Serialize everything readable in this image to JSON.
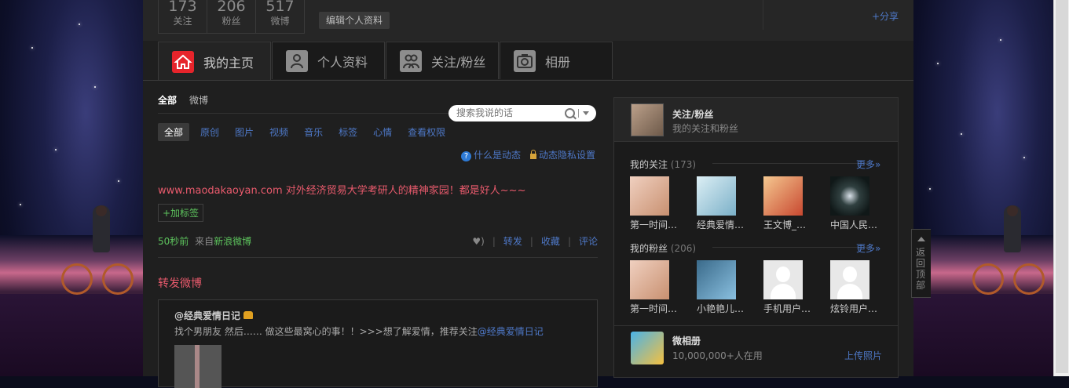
{
  "profile_stats": [
    {
      "value": "173",
      "label": "关注"
    },
    {
      "value": "206",
      "label": "粉丝"
    },
    {
      "value": "517",
      "label": "微博"
    }
  ],
  "edit_profile_label": "编辑个人资料",
  "share_label": "+分享",
  "tabs": [
    {
      "label": "我的主页",
      "icon": "home-icon",
      "active": true
    },
    {
      "label": "个人资料",
      "icon": "person-icon",
      "active": false
    },
    {
      "label": "关注/粉丝",
      "icon": "people-icon",
      "active": false
    },
    {
      "label": "相册",
      "icon": "camera-icon",
      "active": false
    }
  ],
  "feed_tabs": [
    "全部",
    "微博"
  ],
  "search": {
    "placeholder": "搜索我说的话"
  },
  "filters": [
    "全部",
    "原创",
    "图片",
    "视频",
    "音乐",
    "标签",
    "心情",
    "查看权限"
  ],
  "dynamic": {
    "what_is": "什么是动态",
    "privacy": "动态隐私设置"
  },
  "post": {
    "text": "www.maodakaoyan.com 对外经济贸易大学考研人的精神家园！都是好人~~~",
    "add_tag": "+加标签",
    "time": "50秒前",
    "source_prefix": "来自",
    "source": "新浪微博",
    "actions": [
      "转发",
      "收藏",
      "评论"
    ]
  },
  "repost": {
    "title": "转发微博",
    "author": "@经典爱情日记",
    "text": "找个男朋友 然后…… 做这些最窝心的事！！>>>想了解爱情，推荐关注",
    "mention": "@经典爱情日记"
  },
  "sidebar": {
    "header_title": "关注/粉丝",
    "header_sub": "我的关注和粉丝",
    "following_title": "我的关注",
    "following_count": "(173)",
    "followers_title": "我的粉丝",
    "followers_count": "(206)",
    "more": "更多»",
    "following": [
      "第一时间…",
      "经典爱情…",
      "王文博_…",
      "中国人民…"
    ],
    "followers": [
      "第一时间…",
      "小艳艳儿…",
      "手机用户…",
      "炫铃用户…"
    ],
    "album_title": "微相册",
    "album_sub": "10,000,000+人在用",
    "album_upload": "上传照片"
  },
  "back_to_top": "返回顶部",
  "colors": {
    "accent_red": "#e6242b",
    "link_blue": "#4e78c7",
    "green": "#5dc35d",
    "pink_text": "#e85a6c"
  }
}
